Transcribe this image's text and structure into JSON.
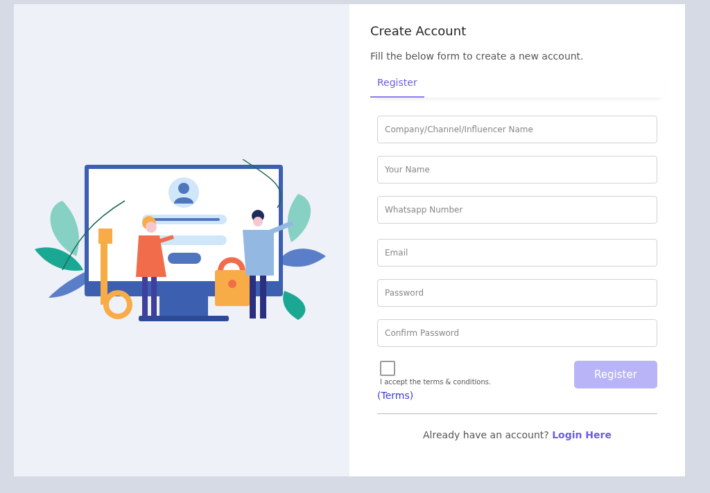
{
  "title": "Create Account",
  "subtitle": "Fill the below form to create a new account.",
  "tabs": [
    {
      "label": "Register",
      "selected": true
    }
  ],
  "fields": [
    {
      "placeholder": "Company/Channel/Influencer Name"
    },
    {
      "placeholder": "Your Name"
    },
    {
      "placeholder": "Whatsapp Number"
    },
    {
      "placeholder": "Email"
    },
    {
      "placeholder": "Password"
    },
    {
      "placeholder": "Confirm Password"
    }
  ],
  "terms": {
    "checked": false,
    "text": "I accept the terms & conditions.",
    "link": "(Terms)"
  },
  "register_button": {
    "label": "Register",
    "disabled": true
  },
  "footer": {
    "text": "Already have an account?",
    "link": "Login Here"
  }
}
